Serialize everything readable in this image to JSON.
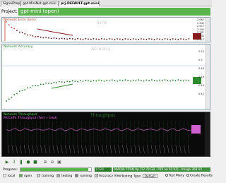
{
  "tabs": [
    {
      "label": "SignalProp"
    },
    {
      "label": "gpt-MiniNet-gpt-mini"
    },
    {
      "label": "prj-DEFAULT-gpt-mini"
    }
  ],
  "project": {
    "label": "Project:",
    "title": "gpt-mini (open)"
  },
  "panels": {
    "error": {
      "label": "Network Error (loss)",
      "watermark": "Error",
      "ticks": [
        "2.667",
        "2.642",
        "2.617",
        "2.592",
        "2.567",
        "2.542",
        "2.517"
      ]
    },
    "accuracy": {
      "label": "Network Accuracy",
      "watermark": "Accuracy",
      "ticks": [
        "0.52",
        "0.5",
        "0.48",
        "0.46",
        "0.44",
        "0.42"
      ]
    },
    "throughput": {
      "label": "Network Throughput",
      "sublabel": "McCaffe Throughput (fwd + bwd)",
      "watermark": "Throughput"
    }
  },
  "toolbar": {
    "buttons": [
      "play-icon",
      "step-icon",
      "pause-icon",
      "record-icon",
      "stop-icon",
      "zoom-in-icon",
      "zoom-out-icon",
      "zoom-fit-icon"
    ]
  },
  "progress": {
    "label": "Progress:",
    "fraction": 0.96,
    "value": "1.526",
    "status": "NVIDIA TITAN Xp (12.79 GB - P2P on 01:42) - Image 308 V2"
  },
  "legend": {
    "items": [
      {
        "label": "local",
        "color": "#ffffff"
      },
      {
        "label": "open",
        "color": "#5ab44c"
      },
      {
        "label": "training",
        "color": "#d0d0d0"
      },
      {
        "label": "testing",
        "color": "#a8a8a8"
      },
      {
        "label": "running",
        "color": "#7a7a7a"
      }
    ],
    "accuracy_view": "Accuracy View",
    "testing_type_label": "Testing Type:",
    "testing_type_value": "Default",
    "test_many": "Test Many",
    "create_results": "Create Results"
  },
  "colors": {
    "accent": "#5ab44c",
    "error_series": "#8b1a1a",
    "accuracy_series": "#2e8b2e",
    "throughput_bg": "#0a0a0a"
  }
}
